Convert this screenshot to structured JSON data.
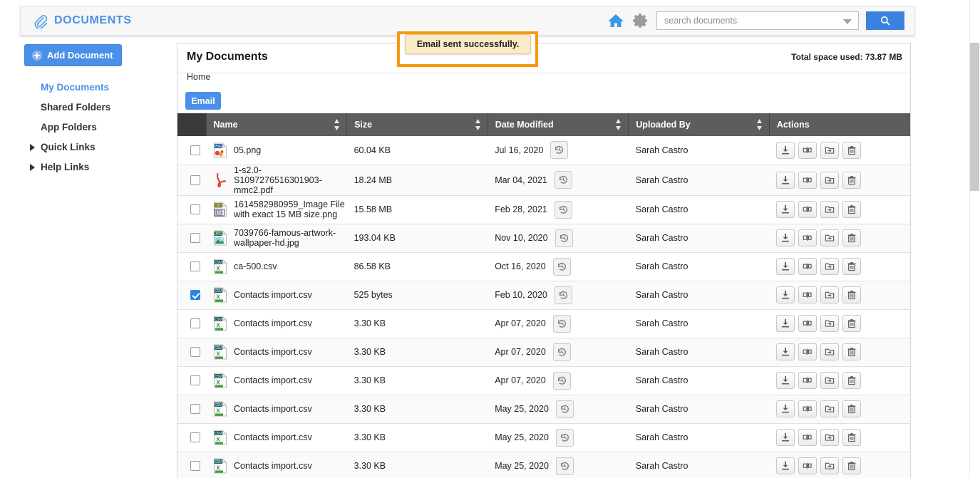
{
  "app": {
    "brand_title": "DOCUMENTS",
    "brand_icon": "paperclip-icon"
  },
  "header": {
    "home_icon": "home-icon",
    "settings_icon": "gear-icon",
    "search_placeholder": "search documents",
    "search_value": "",
    "search_dropdown_icon": "chevron-down-icon",
    "search_button_icon": "search-icon"
  },
  "sidebar": {
    "add_button_label": "Add Document",
    "add_button_icon": "plus-circle-icon",
    "items": [
      {
        "label": "My Documents",
        "active": true,
        "expandable": false
      },
      {
        "label": "Shared Folders",
        "active": false,
        "expandable": false
      },
      {
        "label": "App Folders",
        "active": false,
        "expandable": false
      },
      {
        "label": "Quick Links",
        "active": false,
        "expandable": true
      },
      {
        "label": "Help Links",
        "active": false,
        "expandable": true
      }
    ]
  },
  "main": {
    "title": "My Documents",
    "breadcrumb": "Home",
    "total_space_label": "Total space used: 73.87 MB",
    "email_button_label": "Email"
  },
  "toast": {
    "message": "Email sent successfully.",
    "background": "#faebc8",
    "border": "#dfc98d",
    "annotation_color": "#f59a10"
  },
  "table": {
    "columns": [
      {
        "key": "select",
        "label": "",
        "sortable": false
      },
      {
        "key": "name",
        "label": "Name",
        "sortable": true
      },
      {
        "key": "size",
        "label": "Size",
        "sortable": true
      },
      {
        "key": "date",
        "label": "Date Modified",
        "sortable": true
      },
      {
        "key": "by",
        "label": "Uploaded By",
        "sortable": true
      },
      {
        "key": "act",
        "label": "Actions",
        "sortable": false
      }
    ],
    "row_actions": [
      {
        "name": "download-icon",
        "title": "Download"
      },
      {
        "name": "share-link-icon",
        "title": "Share"
      },
      {
        "name": "move-folder-icon",
        "title": "Move to folder"
      },
      {
        "name": "trash-icon",
        "title": "Delete"
      }
    ],
    "history_icon": "version-history-icon",
    "rows": [
      {
        "selected": false,
        "icon": "png",
        "name": "05.png",
        "size": "60.04 KB",
        "date": "Jul 16, 2020",
        "by": "Sarah Castro"
      },
      {
        "selected": false,
        "icon": "pdf",
        "name": "1-s2.0-S1097276516301903-mmc2.pdf",
        "size": "18.24 MB",
        "date": "Mar 04, 2021",
        "by": "Sarah Castro"
      },
      {
        "selected": false,
        "icon": "unknown",
        "name": "1614582980959_Image File with exact 15 MB size.png",
        "size": "15.58 MB",
        "date": "Feb 28, 2021",
        "by": "Sarah Castro"
      },
      {
        "selected": false,
        "icon": "jpg",
        "name": "7039766-famous-artwork-wallpaper-hd.jpg",
        "size": "193.04 KB",
        "date": "Nov 10, 2020",
        "by": "Sarah Castro"
      },
      {
        "selected": false,
        "icon": "csv",
        "name": "ca-500.csv",
        "size": "86.58 KB",
        "date": "Oct 16, 2020",
        "by": "Sarah Castro"
      },
      {
        "selected": true,
        "icon": "csv",
        "name": "Contacts import.csv",
        "size": "525 bytes",
        "date": "Feb 10, 2020",
        "by": "Sarah Castro"
      },
      {
        "selected": false,
        "icon": "csv",
        "name": "Contacts import.csv",
        "size": "3.30 KB",
        "date": "Apr 07, 2020",
        "by": "Sarah Castro"
      },
      {
        "selected": false,
        "icon": "csv",
        "name": "Contacts import.csv",
        "size": "3.30 KB",
        "date": "Apr 07, 2020",
        "by": "Sarah Castro"
      },
      {
        "selected": false,
        "icon": "csv",
        "name": "Contacts import.csv",
        "size": "3.30 KB",
        "date": "Apr 07, 2020",
        "by": "Sarah Castro"
      },
      {
        "selected": false,
        "icon": "csv",
        "name": "Contacts import.csv",
        "size": "3.30 KB",
        "date": "May 25, 2020",
        "by": "Sarah Castro"
      },
      {
        "selected": false,
        "icon": "csv",
        "name": "Contacts import.csv",
        "size": "3.30 KB",
        "date": "May 25, 2020",
        "by": "Sarah Castro"
      },
      {
        "selected": false,
        "icon": "csv",
        "name": "Contacts import.csv",
        "size": "3.30 KB",
        "date": "May 25, 2020",
        "by": "Sarah Castro"
      }
    ]
  },
  "colors": {
    "accent": "#4a90e8",
    "header_row": "#5d5d5d",
    "select_col": "#3a3a3a",
    "checkbox_on": "#2684e8"
  }
}
